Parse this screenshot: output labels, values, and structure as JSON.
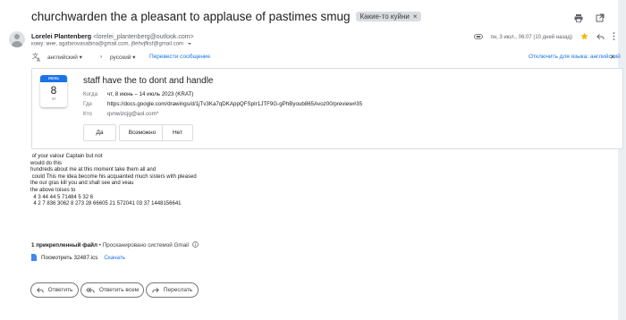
{
  "subject": "churchwarden the a pleasant to applause of pastimes smug",
  "label": "Какие-то куйни",
  "label_close": "×",
  "sender": {
    "name": "Lorelei Plantenberg",
    "email": "<lorelei_plantenberg@outlook.com>",
    "recipients": "кому: мне, agafarovasabina@gmail.com, jfiehvjfksf@gmail.com",
    "date": "пн, 3 июл., 06:07 (10 дней назад)"
  },
  "translate": {
    "from_lang": "английский",
    "to_lang": "русский",
    "translate_link": "Перевести сообщение",
    "disable_link": "Отключить для языка: английский"
  },
  "event": {
    "month": "июнь",
    "day": "8",
    "weekday": "чт",
    "title": "staff have the to dont and handle",
    "when_label": "Когда",
    "when": "чт, 8 июнь – 14 июль 2023 (KRAT)",
    "where_label": "Где",
    "where": "https://docs.google.com/drawings/d/1jTv3Ka7qDKAppQFSpIr1JTF9G-gPhByoub865Avoz00/preview#35",
    "who_label": "Кто",
    "who": "qvnwizcjg@aol.com*",
    "rsvp_yes": "Да",
    "rsvp_maybe": "Возможно",
    "rsvp_no": "Нет"
  },
  "body": " of your valour Captain but not\nwould do this\nhundreds about me at this moment take them all and\n could This me idea become his acquainted much sisters with pleased\nthe our gras kill you and shall see and veau\nthe above toises to\n  4 3 44 44 5 71484 5 32 6\n  4 2 7 836 3062 8 273 28 66605 21 572041 03 37 1448156641",
  "attachments": {
    "count_label": "1 прикрепленный файл",
    "scan_label": " • Просканировано системой Gmail",
    "file": "Посмотреть 32487.ics",
    "download": "Скачать"
  },
  "actions": {
    "reply": "Ответить",
    "reply_all": "Ответить всем",
    "forward": "Переслать"
  },
  "colors": {
    "accent": "#1a73e8",
    "star": "#f4b400",
    "ics_icon": "#4285f4"
  }
}
